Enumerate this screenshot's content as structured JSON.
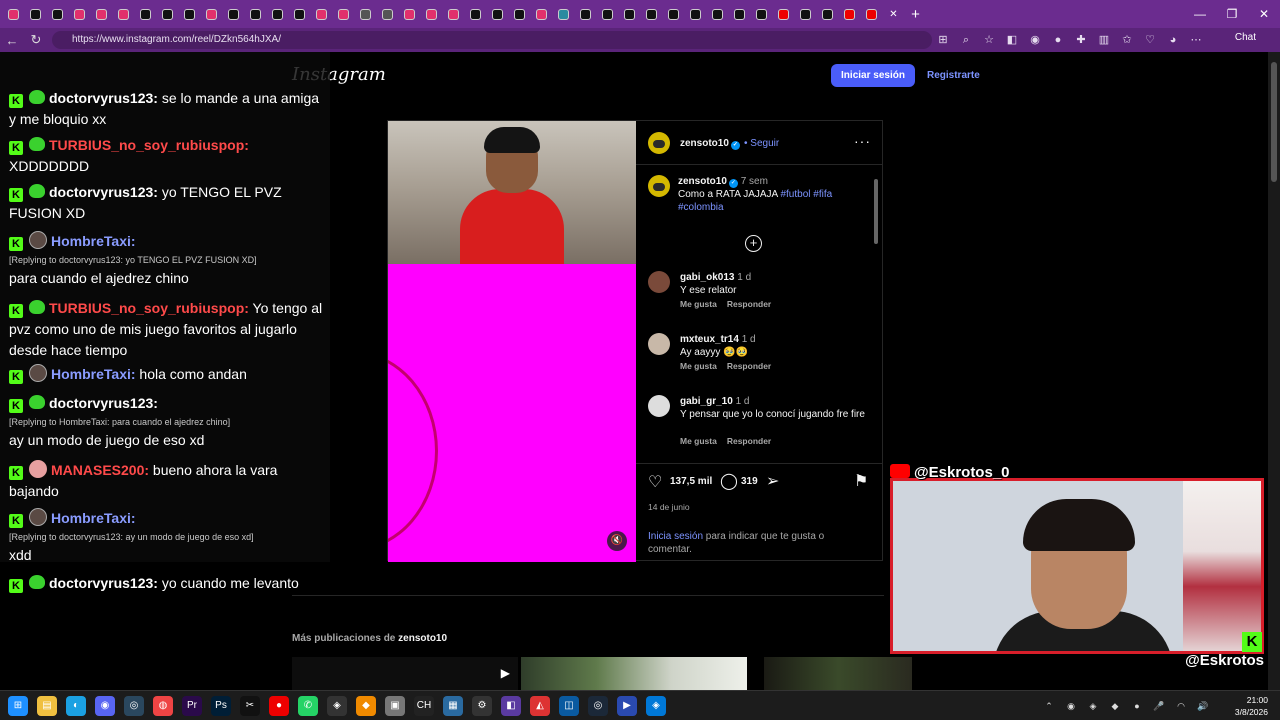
{
  "browser": {
    "url": "https://www.instagram.com/reel/DZkn564hJXA/",
    "chat_label": "Chat"
  },
  "instagram": {
    "logo": "Instagram",
    "login_button": "Iniciar sesión",
    "register_link": "Registrarte",
    "post": {
      "author": "zensoto10",
      "follow": "• Seguir",
      "more": "···",
      "caption_author": "zensoto10",
      "caption_age": "7 sem",
      "caption_text": "Como a RATA JAJAJA",
      "caption_tags": "#futbol #fifa #colombia",
      "comments": [
        {
          "user": "gabi_ok013",
          "age": "1 d",
          "text": "Y ese relator",
          "like": "Me gusta",
          "reply": "Responder"
        },
        {
          "user": "mxteux_tr14",
          "age": "1 d",
          "text": "Ay aayyy 🥹🥹",
          "like": "Me gusta",
          "reply": "Responder"
        },
        {
          "user": "gabi_gr_10",
          "age": "1 d",
          "text": "Y pensar que yo lo conocí jugando fre fire",
          "like": "Me gusta",
          "reply": "Responder"
        }
      ],
      "likes": "137,5 mil",
      "comment_count": "319",
      "date": "14 de junio",
      "login_prompt_link": "Inicia sesión",
      "login_prompt_text": " para indicar que te gusta o comentar."
    },
    "more_posts_prefix": "Más publicaciones de ",
    "more_posts_user": "zensoto10"
  },
  "chat": [
    {
      "user": "doctorvyrus123:",
      "color": "#ffffff",
      "badge": "heart",
      "text": " se lo mande a una amiga y me bloquio xx"
    },
    {
      "user": "TURBIUS_no_soy_rubiuspop:",
      "color": "#ff4a4a",
      "badge": "heart",
      "text": " XDDDDDDD"
    },
    {
      "user": "doctorvyrus123:",
      "color": "#ffffff",
      "badge": "heart",
      "text": " yo TENGO EL PVZ FUSION XD"
    },
    {
      "user": "HombreTaxi:",
      "color": "#8a9cff",
      "badge": "avatar",
      "reply": "[Replying to doctorvyrus123: yo TENGO EL PVZ FUSION XD]",
      "text": "para cuando el ajedrez chino"
    },
    {
      "user": "TURBIUS_no_soy_rubiuspop:",
      "color": "#ff4a4a",
      "badge": "heart",
      "text": " Yo tengo al pvz como uno de mis juego favoritos al jugarlo desde hace tiempo"
    },
    {
      "user": "HombreTaxi:",
      "color": "#8a9cff",
      "badge": "avatar",
      "text": " hola como andan"
    },
    {
      "user": "doctorvyrus123:",
      "color": "#ffffff",
      "badge": "heart",
      "reply": "[Replying to HombreTaxi: para cuando el ajedrez chino]",
      "text": "ay un modo de juego de eso xd"
    },
    {
      "user": "MANASES200:",
      "color": "#ff4a4a",
      "badge": "red",
      "text": " bueno ahora la vara bajando"
    },
    {
      "user": "HombreTaxi:",
      "color": "#8a9cff",
      "badge": "avatar",
      "reply": "[Replying to doctorvyrus123: ay un modo de juego de eso xd]",
      "text": "xdd"
    },
    {
      "user": "doctorvyrus123:",
      "color": "#ffffff",
      "badge": "heart",
      "text": " yo cuando me levanto"
    }
  ],
  "stream_overlay": {
    "top_handle": "@Eskrotos_0",
    "bottom_handle": "@Eskrotos"
  },
  "taskbar": {
    "time": "21:00",
    "date": "3/8/2026"
  }
}
